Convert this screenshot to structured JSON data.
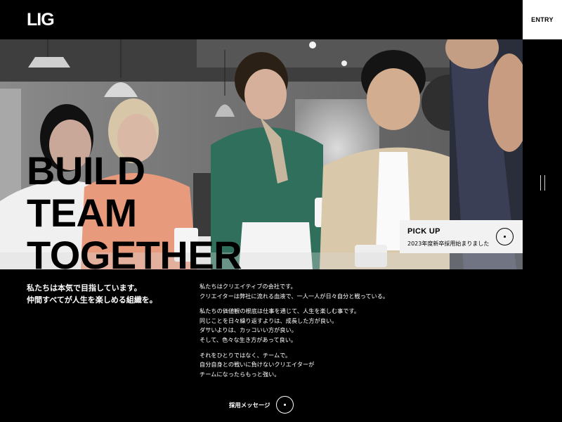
{
  "header": {
    "logo": "LIG",
    "entry_label": "ENTRY"
  },
  "hero": {
    "headline": [
      "BUILD",
      "TEAM",
      "TOGETHER"
    ],
    "pickup": {
      "title": "PICK UP",
      "subtitle": "2023年度新卒採用始まりました"
    }
  },
  "intro": {
    "lead": [
      "私たちは本気で目指しています。",
      "仲間すべてが人生を楽しめる組織を。"
    ],
    "paragraphs": [
      [
        "私たちはクリエイティブの会社です。",
        "クリエイターは弊社に流れる血液で、一人一人が日々自分と戦っている。"
      ],
      [
        "私たちの価値観の根底は仕事を通じて、人生を楽しむ事です。",
        "同じことを日々繰り返すよりは、成長した方が良い。",
        "ダサいよりは、カッコいい方が良い。",
        "そして、色々な生き方があって良い。"
      ],
      [
        "それをひとりではなく、チームで。",
        "自分自身との戦いに負けないクリエイターが",
        "チームになったらもっと強い。"
      ]
    ]
  },
  "cta": {
    "message_label": "採用メッセージ"
  },
  "colors": {
    "background": "#000000",
    "text": "#ffffff",
    "pickup_bg": "#f2f2f2"
  }
}
